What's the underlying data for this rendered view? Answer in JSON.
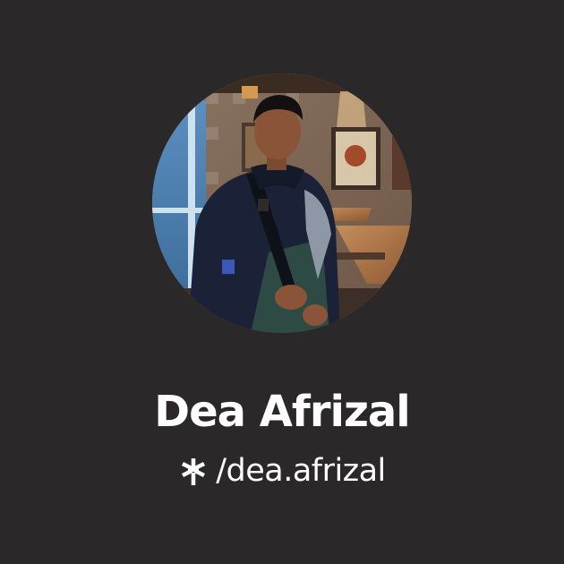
{
  "profile": {
    "name": "Dea Afrizal",
    "handle": "/dea.afrizal",
    "avatar_icon": "profile-photo",
    "handle_icon": "linktree-asterisk-icon"
  },
  "colors": {
    "background": "#2b2829",
    "text": "#ffffff"
  }
}
